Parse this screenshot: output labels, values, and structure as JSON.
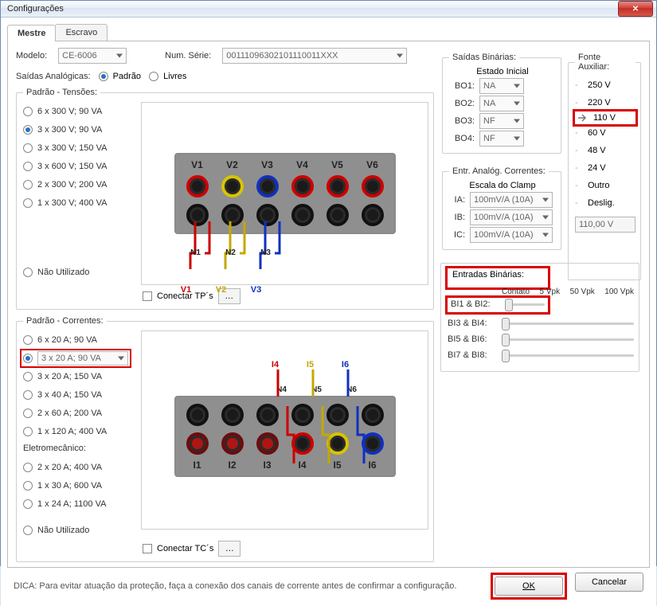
{
  "window": {
    "title": "Configurações"
  },
  "tabs": {
    "mestre": "Mestre",
    "escravo": "Escravo"
  },
  "model": {
    "label": "Modelo:",
    "value": "CE-6006"
  },
  "serial": {
    "label": "Num. Série:",
    "value": "00111096302101110011XXX"
  },
  "analog": {
    "label": "Saídas Analógicas:",
    "padrao": "Padrão",
    "livres": "Livres"
  },
  "tensoes": {
    "legend": "Padrão - Tensões:",
    "options": [
      "6 x 300 V; 90 VA",
      "3 x 300 V; 90 VA",
      "3 x 300 V; 150 VA",
      "3 x 600 V; 150 VA",
      "2 x 300 V; 200 VA",
      "1 x 300 V; 400 VA"
    ],
    "selected_index": 1,
    "nao_utilizado": "Não Utilizado",
    "conectar": "Conectar TP´s",
    "vlabels": [
      "V1",
      "V2",
      "V3",
      "V4",
      "V5",
      "V6"
    ],
    "nlabels": [
      "N1",
      "N2",
      "N3"
    ],
    "wlabels": [
      "V1",
      "V2",
      "V3"
    ]
  },
  "correntes": {
    "legend": "Padrão - Correntes:",
    "options": [
      "6 x 20 A; 90 VA",
      "3 x 20 A; 90 VA",
      "3 x 20 A; 150 VA",
      "3 x 40 A; 150 VA",
      "2 x 60 A; 200 VA",
      "1 x 120 A; 400 VA"
    ],
    "selected_index": 1,
    "eletro_legend": "Eletromecânico:",
    "eletro_options": [
      "2 x 20 A; 400 VA",
      "1 x 30 A; 600 VA",
      "1 x 24 A; 1100 VA"
    ],
    "nao_utilizado": "Não Utilizado",
    "conectar": "Conectar TC´s",
    "ilabels": [
      "I1",
      "I2",
      "I3",
      "I4",
      "I5",
      "I6"
    ],
    "nlabels": [
      "N4",
      "N5",
      "N6"
    ],
    "top_i": [
      "I4",
      "I5",
      "I6"
    ]
  },
  "saidas_bin": {
    "legend": "Saídas Binárias:",
    "estado": "Estado Inicial",
    "rows": [
      {
        "label": "BO1:",
        "value": "NA"
      },
      {
        "label": "BO2:",
        "value": "NA"
      },
      {
        "label": "BO3:",
        "value": "NF"
      },
      {
        "label": "BO4:",
        "value": "NF"
      }
    ]
  },
  "entr_analog": {
    "legend": "Entr. Analóg. Correntes:",
    "escala": "Escala do Clamp",
    "rows": [
      {
        "label": "IA:",
        "value": "100mV/A (10A)"
      },
      {
        "label": "IB:",
        "value": "100mV/A (10A)"
      },
      {
        "label": "IC:",
        "value": "100mV/A (10A)"
      }
    ]
  },
  "entr_bin": {
    "legend": "Entradas Binárias:",
    "scale": [
      "Contato",
      "5 Vpk",
      "50 Vpk",
      "100 Vpk"
    ],
    "rows": [
      "BI1 & BI2:",
      "BI3 & BI4:",
      "BI5 & BI6:",
      "BI7 & BI8:"
    ]
  },
  "fonte": {
    "legend": "Fonte Auxiliar:",
    "options": [
      "250 V",
      "220 V",
      "110 V",
      "60 V",
      "48 V",
      "24 V",
      "Outro",
      "Deslig."
    ],
    "selected_index": 2,
    "box": "110,00 V"
  },
  "hint": "DICA: Para evitar atuação da proteção, faça a conexão dos canais de corrente antes de confirmar a configuração.",
  "buttons": {
    "ok": "OK",
    "cancel": "Cancelar"
  }
}
